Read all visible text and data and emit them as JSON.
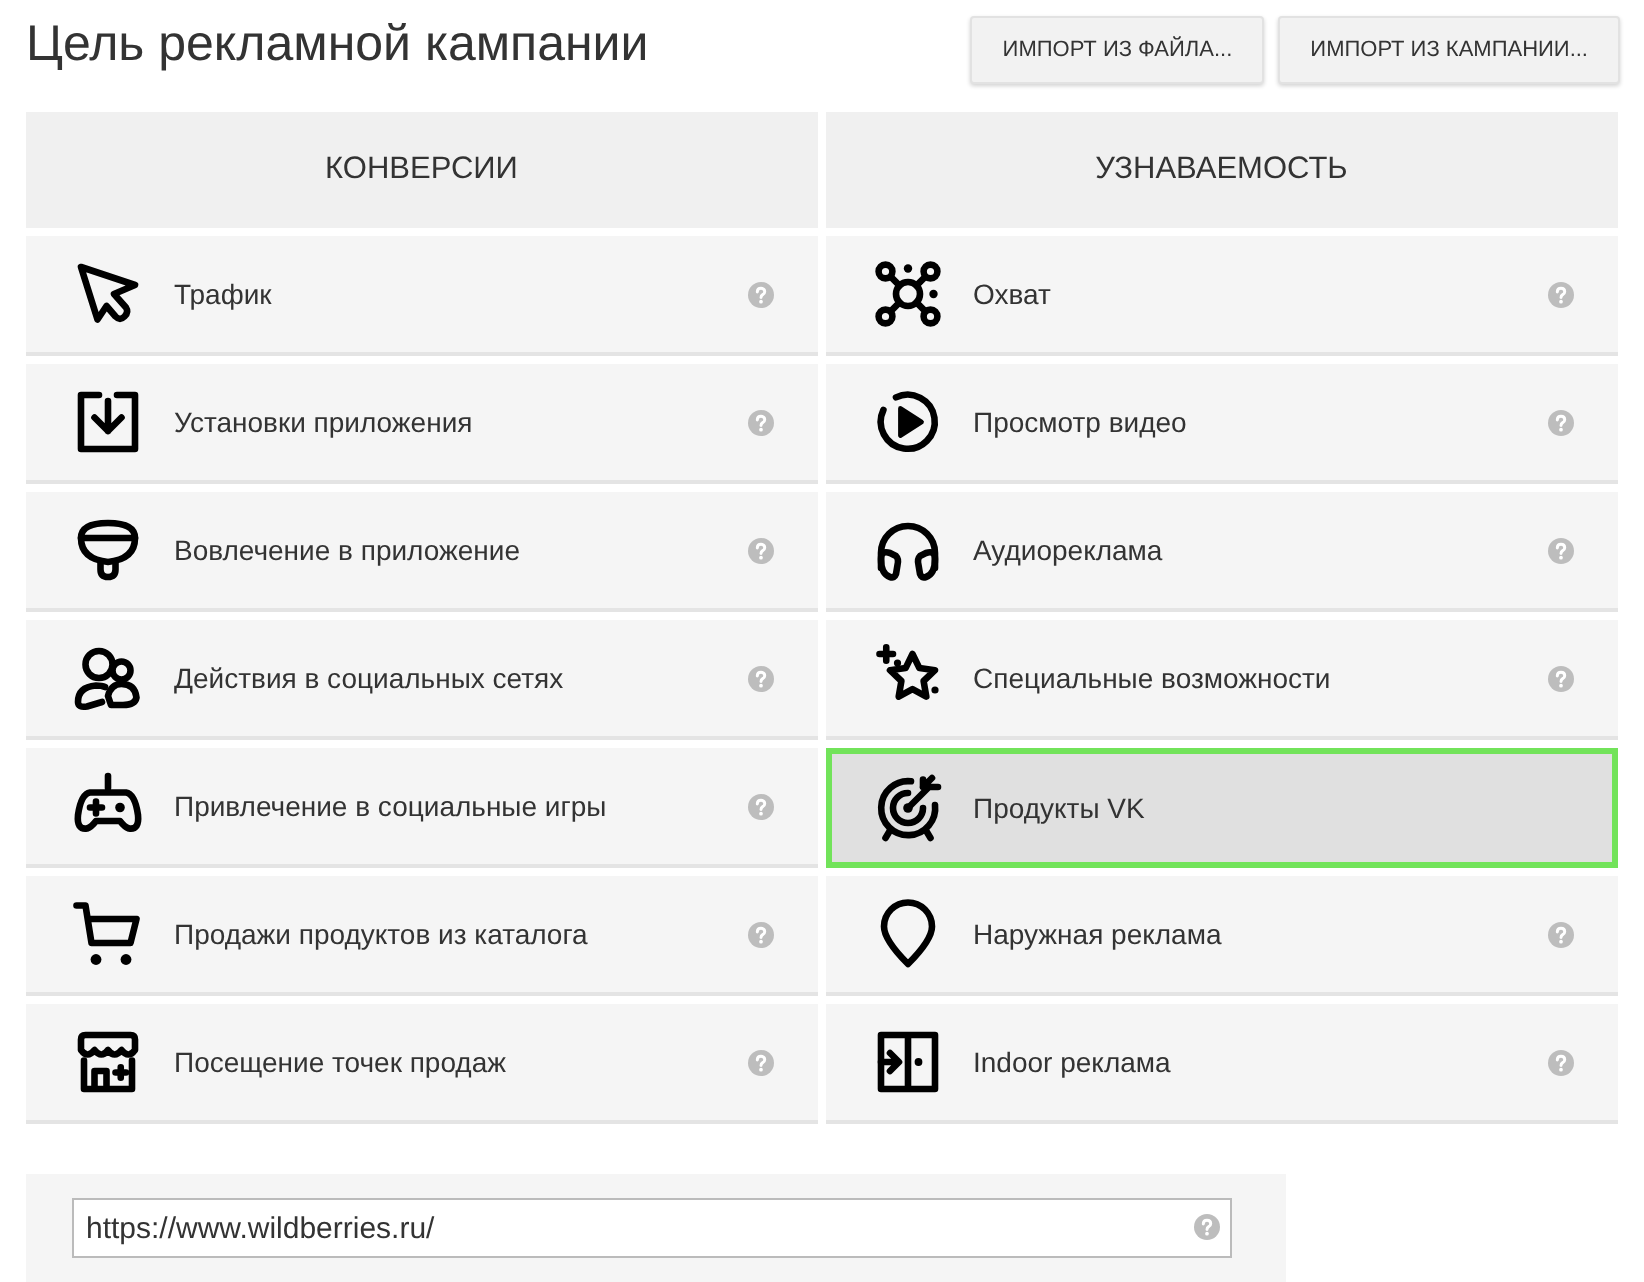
{
  "page": {
    "title": "Цель рекламной кампании"
  },
  "import_buttons": [
    "ИМПОРТ ИЗ ФАЙЛА...",
    "ИМПОРТ ИЗ КАМПАНИИ..."
  ],
  "objectives": {
    "columns": [
      {
        "heading": "КОНВЕРСИИ",
        "items": [
          {
            "label": "Трафик",
            "kind": "cursor",
            "selected": false
          },
          {
            "label": "Установки приложения",
            "kind": "download",
            "selected": false
          },
          {
            "label": "Вовлечение в приложение",
            "kind": "bowl",
            "selected": false
          },
          {
            "label": "Действия в социальных сетях",
            "kind": "people",
            "selected": false
          },
          {
            "label": "Привлечение в социальные игры",
            "kind": "gamepad",
            "selected": false
          },
          {
            "label": "Продажи продуктов из каталога",
            "kind": "cart",
            "selected": false
          },
          {
            "label": "Посещение точек продаж",
            "kind": "store",
            "selected": false
          }
        ]
      },
      {
        "heading": "УЗНАВАЕМОСТЬ",
        "items": [
          {
            "label": "Охват",
            "kind": "network",
            "selected": false
          },
          {
            "label": "Просмотр видео",
            "kind": "play",
            "selected": false
          },
          {
            "label": "Аудиореклама",
            "kind": "headphones",
            "selected": false
          },
          {
            "label": "Специальные возможности",
            "kind": "star",
            "selected": false
          },
          {
            "label": "Продукты VK",
            "kind": "target",
            "selected": true
          },
          {
            "label": "Наружная реклама",
            "kind": "pin",
            "selected": false
          },
          {
            "label": "Indoor реклама",
            "kind": "door",
            "selected": false
          }
        ]
      }
    ]
  },
  "url_field": {
    "value": "https://www.wildberries.ru/"
  }
}
